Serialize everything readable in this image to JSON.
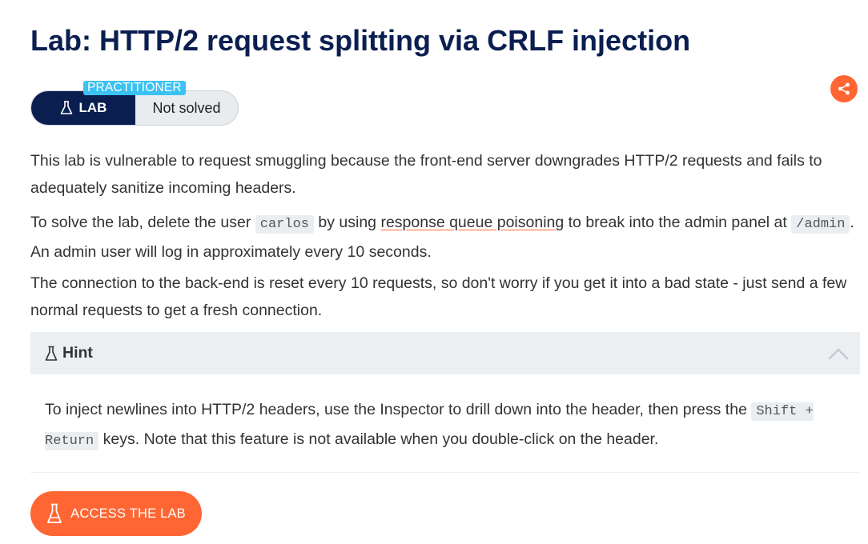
{
  "page": {
    "title": "Lab: HTTP/2 request splitting via CRLF injection"
  },
  "lab_status": {
    "level": "PRACTITIONER",
    "type_label": "LAB",
    "state": "Not solved",
    "type_icon": "flask-icon"
  },
  "share": {
    "icon": "share-icon",
    "color": "#ff6633"
  },
  "description": {
    "p1": "This lab is vulnerable to request smuggling because the front-end server downgrades HTTP/2 requests and fails to adequately sanitize incoming headers.",
    "p2_before_user": "To solve the lab, delete the user ",
    "p2_user": "carlos",
    "p2_between": " by using ",
    "p2_link": "response queue poisoning",
    "p2_after_link": " to break into the admin panel at ",
    "p2_path": "/admin",
    "p2_end": ". An admin user will log in approximately every 10 seconds.",
    "p3": "The connection to the back-end is reset every 10 requests, so don't worry if you get it into a bad state - just send a few normal requests to get a fresh connection."
  },
  "hint": {
    "label": "Hint",
    "icon": "flask-icon",
    "toggle_icon": "chevron-up-icon",
    "text_before": "To inject newlines into HTTP/2 headers, use the Inspector to drill down into the header, then press the ",
    "keys": "Shift + Return",
    "text_after": " keys. Note that this feature is not available when you double-click on the header."
  },
  "access_button": {
    "label": "ACCESS THE LAB",
    "icon": "flask-icon"
  },
  "colors": {
    "title": "#0a1e50",
    "accent": "#ff6633",
    "level_badge": "#3cc2f2",
    "hint_bg": "#ebeff2"
  }
}
